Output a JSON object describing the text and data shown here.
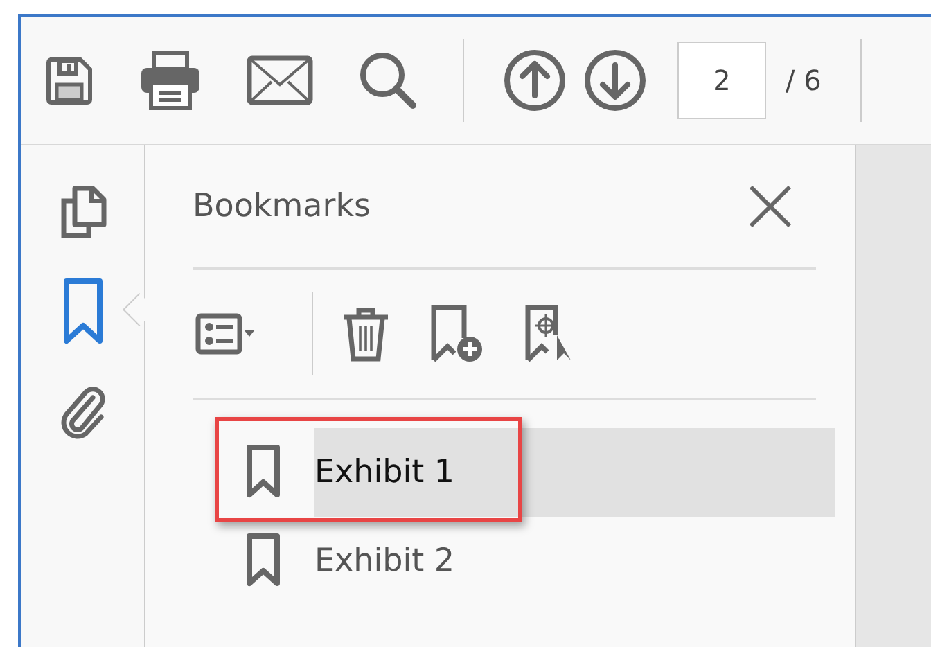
{
  "toolbar": {
    "tools": [
      {
        "kind": "save"
      },
      {
        "kind": "print"
      },
      {
        "kind": "mail"
      },
      {
        "kind": "search"
      }
    ],
    "navigation": [
      {
        "kind": "up"
      },
      {
        "kind": "down"
      }
    ],
    "page_field": {
      "value": "2"
    },
    "page_total": "/ 6"
  },
  "rail": [
    {
      "kind": "pages",
      "selected": false
    },
    {
      "kind": "bookmarks",
      "selected": true
    },
    {
      "kind": "attachments",
      "selected": false
    }
  ],
  "panel": {
    "title": "Bookmarks",
    "tools": [
      {
        "kind": "options"
      },
      {
        "kind": "delete"
      },
      {
        "kind": "add"
      },
      {
        "kind": "find"
      }
    ],
    "bookmarks": [
      {
        "label": "Exhibit 1",
        "selected": true,
        "annotated": true
      },
      {
        "label": "Exhibit 2",
        "selected": false,
        "annotated": false
      }
    ]
  }
}
